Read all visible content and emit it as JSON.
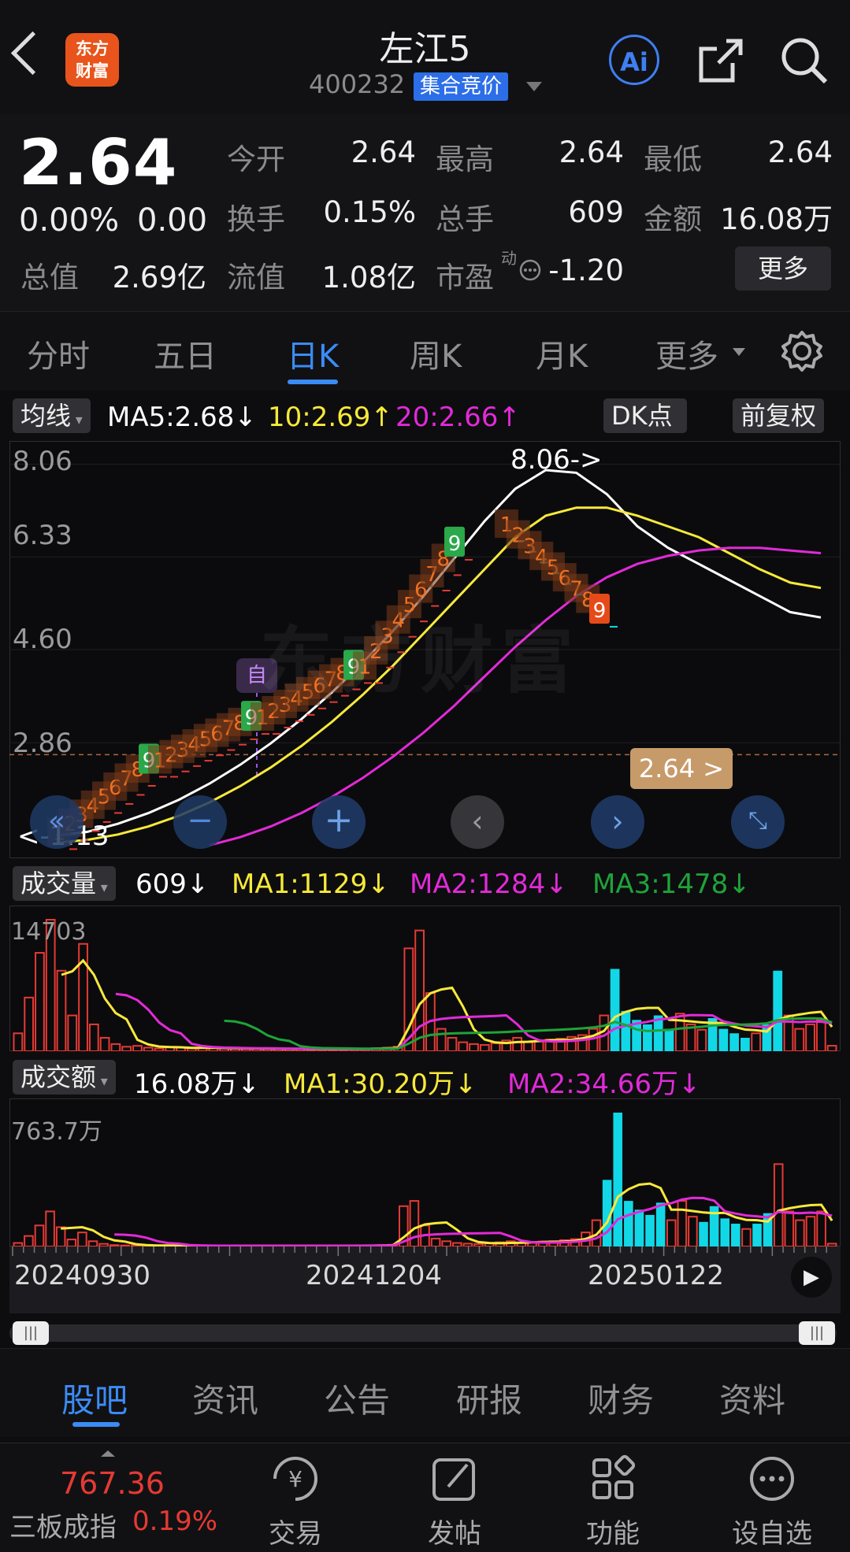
{
  "header": {
    "back": "back",
    "logo_text": "东方\n财富",
    "title": "左江5",
    "code": "400232",
    "auction_badge": "集合竞价"
  },
  "quote": {
    "price": "2.64",
    "change_pct": "0.00%",
    "change": "0.00",
    "fields": [
      {
        "label": "今开",
        "value": "2.64"
      },
      {
        "label": "最高",
        "value": "2.64"
      },
      {
        "label": "最低",
        "value": "2.64"
      },
      {
        "label": "换手",
        "value": "0.15%"
      },
      {
        "label": "总手",
        "value": "609"
      },
      {
        "label": "金额",
        "value": "16.08万"
      }
    ],
    "total_cap_label": "总值",
    "total_cap": "2.69亿",
    "float_cap_label": "流值",
    "float_cap": "1.08亿",
    "pe_label": "市盈",
    "pe_sup": "动",
    "pe_value": "-1.20",
    "more": "更多"
  },
  "period_tabs": [
    "分时",
    "五日",
    "日K",
    "周K",
    "月K",
    "更多"
  ],
  "active_period": "日K",
  "ma_bar": {
    "selector": "均线",
    "ma5": "MA5:2.68",
    "ma5_arrow": "↓",
    "ma10": "10:2.69",
    "ma10_arrow": "↑",
    "ma20": "20:2.66",
    "ma20_arrow": "↑",
    "dk": "DK点",
    "adjust": "前复权"
  },
  "colors": {
    "ma5": "#ffffff",
    "ma10": "#f7e93a",
    "ma20": "#e22ad8",
    "up": "#e53a34",
    "down": "#12d7e6",
    "accent": "#3b8cf5",
    "badge_green": "#2aa84a",
    "badge_red": "#e64a19"
  },
  "chart_data": [
    {
      "type": "line",
      "title": "日K",
      "y_ticks": [
        "8.06",
        "6.33",
        "4.60",
        "2.86"
      ],
      "high_label": "8.06->",
      "low_label": "<-1.13",
      "current_price_tag": "2.64 >",
      "self_marker": "自",
      "watermark": "东方财富",
      "series": [
        {
          "name": "MA5",
          "values": [
            1.13,
            1.2,
            1.35,
            1.55,
            1.8,
            2.1,
            2.45,
            2.85,
            3.3,
            3.8,
            4.35,
            4.95,
            5.6,
            6.3,
            7.0,
            7.6,
            7.95,
            7.9,
            7.5,
            6.9,
            6.5,
            6.2,
            5.9,
            5.6,
            5.3,
            5.2
          ]
        },
        {
          "name": "10",
          "values": [
            1.0,
            1.05,
            1.15,
            1.3,
            1.5,
            1.75,
            2.05,
            2.4,
            2.8,
            3.25,
            3.75,
            4.3,
            4.9,
            5.5,
            6.1,
            6.7,
            7.1,
            7.25,
            7.25,
            7.1,
            6.9,
            6.7,
            6.4,
            6.1,
            5.85,
            5.75
          ]
        },
        {
          "name": "20",
          "values": [
            null,
            null,
            null,
            null,
            null,
            0.95,
            1.1,
            1.3,
            1.55,
            1.85,
            2.2,
            2.6,
            3.05,
            3.55,
            4.1,
            4.65,
            5.15,
            5.6,
            5.95,
            6.2,
            6.35,
            6.45,
            6.5,
            6.5,
            6.45,
            6.4
          ]
        }
      ],
      "td_sequence_labels": [
        "1",
        "2",
        "3",
        "4",
        "5",
        "6",
        "7",
        "8",
        "9"
      ]
    },
    {
      "type": "bar",
      "title": "成交量",
      "value": "609",
      "value_arrow": "↓",
      "ma1": "MA1:1129",
      "ma1_arrow": "↓",
      "ma2": "MA2:1284",
      "ma2_arrow": "↓",
      "ma3": "MA3:1478",
      "ma3_arrow": "↓",
      "ymax_label": "14703",
      "values": [
        2000,
        6000,
        11000,
        14703,
        9000,
        4000,
        12000,
        3000,
        1500,
        800,
        500,
        600,
        400,
        300,
        500,
        400,
        300,
        400,
        350,
        300,
        280,
        250,
        300,
        280,
        260,
        240,
        230,
        200,
        220,
        200,
        250,
        300,
        280,
        350,
        400,
        500,
        11500,
        13500,
        6500,
        2500,
        1500,
        1000,
        800,
        700,
        900,
        1200,
        1500,
        1000,
        1100,
        1300,
        1400,
        1600,
        1800,
        2500,
        4000,
        9200,
        4500,
        3500,
        3000,
        4000,
        2500,
        4200,
        3000,
        2400,
        3700,
        2500,
        2000,
        1500,
        2000,
        3000,
        9000,
        4000,
        2500,
        3000,
        3500,
        609
      ]
    },
    {
      "type": "bar",
      "title": "成交额",
      "value": "16.08万",
      "value_arrow": "↓",
      "ma1": "MA1:30.20万",
      "ma1_arrow": "↓",
      "ma2": "MA2:34.66万",
      "ma2_arrow": "↓",
      "ymax_label": "763.7万",
      "values": [
        20,
        60,
        120,
        200,
        110,
        40,
        80,
        30,
        15,
        8,
        6,
        6,
        5,
        4,
        5,
        4,
        4,
        4,
        4,
        4,
        4,
        4,
        4,
        4,
        4,
        4,
        4,
        4,
        4,
        4,
        4,
        5,
        5,
        6,
        8,
        10,
        230,
        260,
        120,
        45,
        30,
        20,
        16,
        14,
        18,
        24,
        30,
        22,
        24,
        28,
        30,
        36,
        42,
        80,
        150,
        380,
        763.7,
        260,
        210,
        180,
        250,
        150,
        260,
        170,
        140,
        230,
        160,
        130,
        100,
        130,
        190,
        470,
        200,
        150,
        170,
        200,
        16
      ]
    }
  ],
  "dates": [
    "20240930",
    "20241204",
    "20250122"
  ],
  "bottom_tabs": [
    "股吧",
    "资讯",
    "公告",
    "研报",
    "财务",
    "资料"
  ],
  "active_bottom_tab": "股吧",
  "index": {
    "value": "767.36",
    "name": "三板成指",
    "pct": "0.19%"
  },
  "nav": [
    "交易",
    "发帖",
    "功能",
    "设自选"
  ]
}
